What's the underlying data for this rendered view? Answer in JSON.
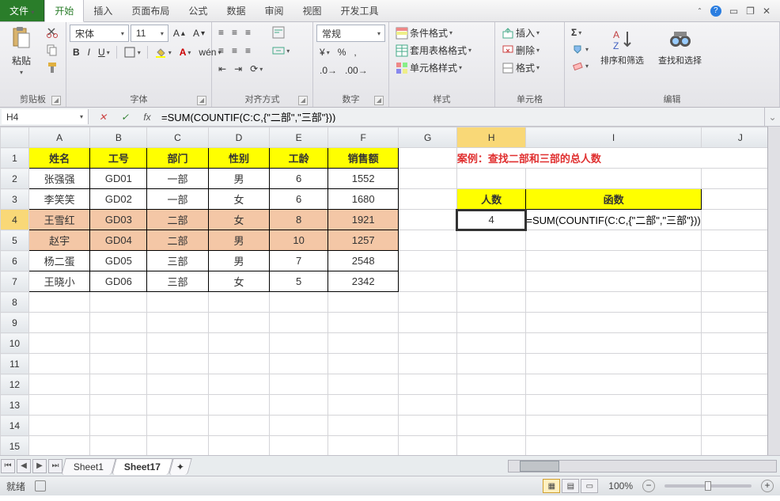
{
  "menu": {
    "file": "文件",
    "tabs": [
      "开始",
      "插入",
      "页面布局",
      "公式",
      "数据",
      "审阅",
      "视图",
      "开发工具"
    ]
  },
  "ribbon": {
    "clipboard": {
      "paste": "粘贴",
      "label": "剪贴板"
    },
    "font": {
      "name": "宋体",
      "size": "11",
      "label": "字体"
    },
    "align": {
      "label": "对齐方式",
      "wrap": "",
      "merge": ""
    },
    "number": {
      "combo": "常规",
      "label": "数字"
    },
    "styles": {
      "cond": "条件格式",
      "table": "套用表格格式",
      "cell": "单元格样式",
      "label": "样式"
    },
    "cells": {
      "insert": "插入",
      "delete": "删除",
      "format": "格式",
      "label": "单元格"
    },
    "editing": {
      "sort": "排序和筛选",
      "find": "查找和选择",
      "label": "编辑"
    }
  },
  "namebox": "H4",
  "formula": "=SUM(COUNTIF(C:C,{\"二部\",\"三部\"}))",
  "cols": [
    "A",
    "B",
    "C",
    "D",
    "E",
    "F",
    "G",
    "H",
    "I",
    "J"
  ],
  "table": {
    "headers": [
      "姓名",
      "工号",
      "部门",
      "性别",
      "工龄",
      "销售额"
    ],
    "rows": [
      [
        "张强强",
        "GD01",
        "一部",
        "男",
        "6",
        "1552"
      ],
      [
        "李笑笑",
        "GD02",
        "一部",
        "女",
        "6",
        "1680"
      ],
      [
        "王雪红",
        "GD03",
        "二部",
        "女",
        "8",
        "1921"
      ],
      [
        "赵宇",
        "GD04",
        "二部",
        "男",
        "10",
        "1257"
      ],
      [
        "杨二蛋",
        "GD05",
        "三部",
        "男",
        "7",
        "2548"
      ],
      [
        "王晓小",
        "GD06",
        "三部",
        "女",
        "5",
        "2342"
      ]
    ],
    "highlight_rows": [
      2,
      3
    ]
  },
  "case_label": "案例：查找二部和三部的总人数",
  "result": {
    "h3": "人数",
    "i3": "函数",
    "h4": "4",
    "i4": "=SUM(COUNTIF(C:C,{\"二部\",\"三部\"}))"
  },
  "sheets": [
    "Sheet1",
    "Sheet17"
  ],
  "active_sheet": 1,
  "status": {
    "ready": "就绪",
    "zoom": "100%"
  }
}
